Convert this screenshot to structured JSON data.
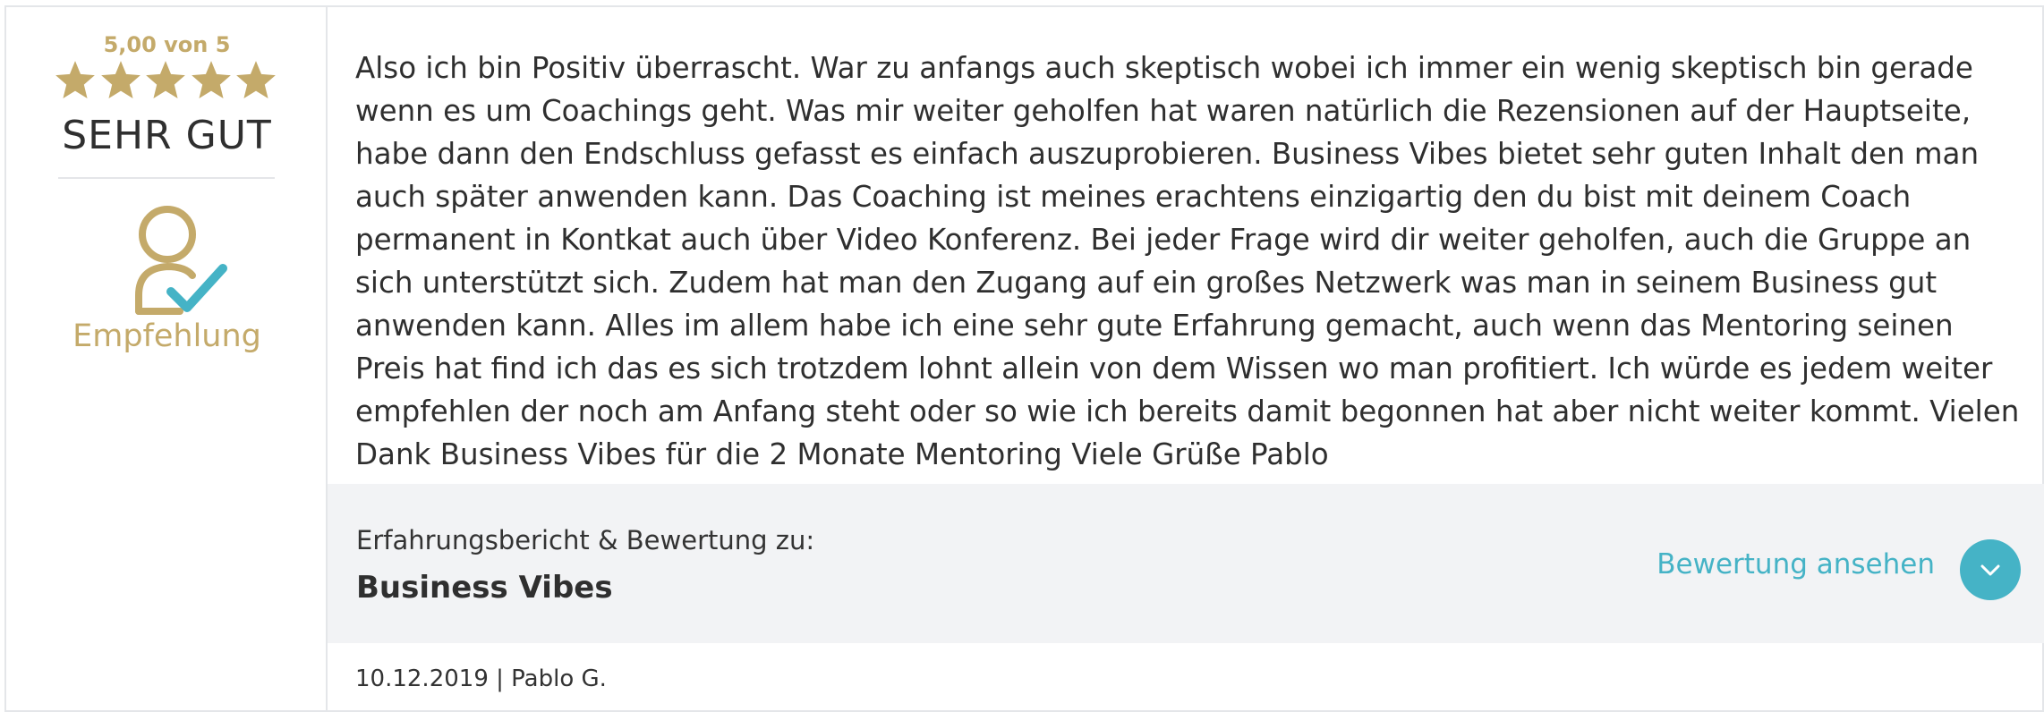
{
  "rating": {
    "score_text": "5,00 von 5",
    "value": 5,
    "max": 5,
    "verdict": "SEHR GUT",
    "star_color": "#c4aa6a"
  },
  "recommendation": {
    "label": "Empfehlung",
    "icon": "user-check-icon"
  },
  "review": {
    "text": "Also ich bin Positiv überrascht. War zu anfangs auch skeptisch wobei ich immer ein wenig skeptisch bin gerade wenn es um Coachings geht. Was mir weiter geholfen hat waren natürlich die Rezensionen auf der Hauptseite, habe dann den Endschluss gefasst es einfach auszuprobieren. Business Vibes bietet sehr guten Inhalt den man auch später anwenden kann. Das Coaching ist meines erachtens einzigartig den du bist mit deinem Coach permanent in Kontkat auch über Video Konferenz. Bei jeder Frage wird dir weiter geholfen, auch die Gruppe an sich unterstützt sich. Zudem hat man den Zugang auf ein großes Netzwerk was man in seinem Business gut anwenden kann. Alles im allem habe ich eine sehr gute Erfahrung gemacht, auch wenn das Mentoring seinen Preis hat find ich das es sich trotzdem lohnt allein von dem Wissen wo man profitiert. Ich würde es jedem weiter empfehlen der noch am Anfang steht oder so wie ich bereits damit begonnen hat aber nicht weiter kommt. Vielen Dank Business Vibes für die 2 Monate Mentoring Viele Grüße Pablo"
  },
  "meta": {
    "label": "Erfahrungsbericht & Bewertung zu:",
    "company": "Business Vibes",
    "view_label": "Bewertung ansehen",
    "view_icon": "chevron-down-icon",
    "accent_color": "#45b3c6"
  },
  "footer": {
    "date_author": "10.12.2019 | Pablo G."
  }
}
